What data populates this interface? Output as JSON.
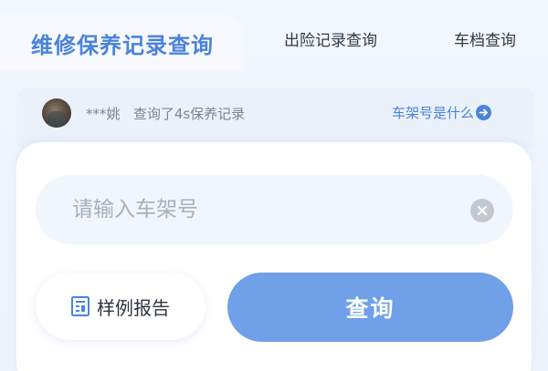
{
  "tabs": [
    {
      "label": "维修保养记录查询",
      "active": true
    },
    {
      "label": "出险记录查询",
      "active": false
    },
    {
      "label": "车档查询",
      "active": false
    }
  ],
  "activity": {
    "user": "***姚",
    "action": "查询了4s保养记录",
    "help_link": "车架号是什么"
  },
  "search": {
    "placeholder": "请输入车架号",
    "value": ""
  },
  "buttons": {
    "sample_report": "样例报告",
    "query": "查询"
  },
  "colors": {
    "accent": "#4a83dc",
    "primary_button": "#6fa0e8",
    "background": "#eef3fb"
  },
  "icons": [
    "arrow-right-circle-icon",
    "clear-icon",
    "report-icon"
  ]
}
